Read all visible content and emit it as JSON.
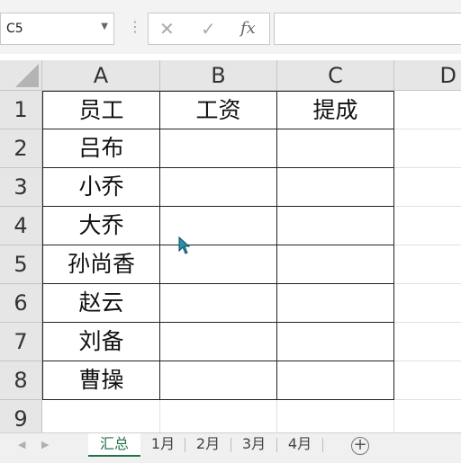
{
  "name_box": {
    "value": "C5"
  },
  "formula_bar": {
    "cancel": "✕",
    "enter": "✓",
    "function": "fx",
    "value": ""
  },
  "columns": [
    "A",
    "B",
    "C",
    "D"
  ],
  "rows": [
    "1",
    "2",
    "3",
    "4",
    "5",
    "6",
    "7",
    "8",
    "9"
  ],
  "table": {
    "headers": [
      "员工",
      "工资",
      "提成"
    ],
    "employees": [
      "吕布",
      "小乔",
      "大乔",
      "孙尚香",
      "赵云",
      "刘备",
      "曹操"
    ]
  },
  "sheet_tabs": {
    "active": "汇总",
    "tabs": [
      "汇总",
      "1月",
      "2月",
      "3月",
      "4月"
    ]
  }
}
